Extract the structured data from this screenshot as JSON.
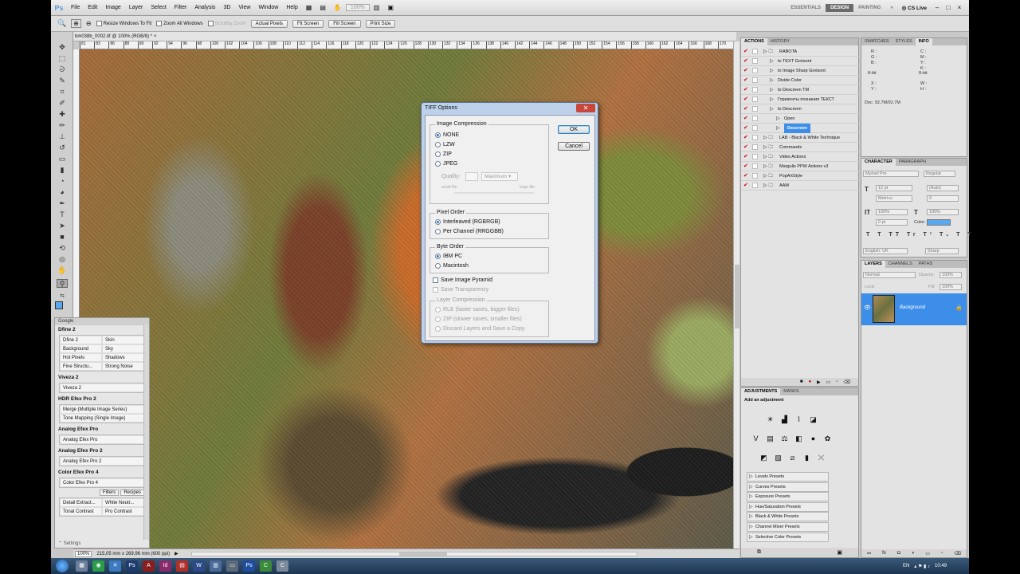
{
  "app": {
    "menu": [
      "File",
      "Edit",
      "Image",
      "Layer",
      "Select",
      "Filter",
      "Analysis",
      "3D",
      "View",
      "Window",
      "Help"
    ],
    "zoom_select": "100%",
    "workspaces": [
      "ESSENTIALS",
      "DESIGN",
      "PAINTING"
    ],
    "active_workspace": "DESIGN",
    "more": "»",
    "cs_live": "CS Live"
  },
  "options": {
    "resize_windows": "Resize Windows To Fit",
    "zoom_all": "Zoom All Windows",
    "scrubby": "Scrubby Zoom",
    "buttons": [
      "Actual Pixels",
      "Fit Screen",
      "Fill Screen",
      "Print Size"
    ]
  },
  "document": {
    "tab": "bm038b_0002.tif @ 100% (RGB/8) *",
    "ruler_ticks": [
      "81",
      "83",
      "86",
      "88",
      "90",
      "92",
      "94",
      "96",
      "98",
      "100",
      "102",
      "104",
      "106",
      "108",
      "110",
      "112",
      "114",
      "116",
      "118",
      "120",
      "122",
      "124",
      "126",
      "128",
      "130",
      "132",
      "134",
      "136",
      "138",
      "140",
      "142",
      "144",
      "146",
      "148",
      "150",
      "152",
      "154",
      "156",
      "158",
      "160",
      "162",
      "164",
      "166",
      "168",
      "170"
    ],
    "status_zoom": "100%",
    "status_size": "215,05 mm x 269,96 mm (600 ppi)"
  },
  "google_panel": {
    "title": "Google",
    "sections": [
      {
        "name": "Dfine 2",
        "items": [
          "Dfine 2",
          "Skin",
          "Background",
          "Sky",
          "Hot Pixels",
          "Shadows",
          "Fine Structu...",
          "Strong Noise"
        ]
      },
      {
        "name": "Viveza 2",
        "items": [
          "Viveza 2"
        ]
      },
      {
        "name": "HDR Efex Pro 2",
        "items": [
          "Merge (Multiple Image Series)",
          "Tone Mapping (Single Image)"
        ]
      },
      {
        "name": "Analog Efex Pro",
        "items": [
          "Analog Efex Pro"
        ]
      },
      {
        "name": "Analog Efex Pro 2",
        "items": [
          "Analog Efex Pro 2"
        ]
      },
      {
        "name": "Color Efex Pro 4",
        "items": [
          "Color Efex Pro 4"
        ]
      }
    ],
    "tabs": [
      "Filters",
      "Recipes"
    ],
    "bottom_items": [
      "Detail Extract...",
      "White Neutr...",
      "Tonal Contrast",
      "Pro Contrast"
    ],
    "settings": "Settings"
  },
  "dialog": {
    "title": "TIFF Options",
    "ok": "OK",
    "cancel": "Cancel",
    "image_compression": {
      "label": "Image Compression",
      "options": [
        "NONE",
        "LZW",
        "ZIP",
        "JPEG"
      ],
      "selected": "NONE",
      "quality_label": "Quality:",
      "quality_select": "Maximum",
      "small_file": "small file",
      "large_file": "large file"
    },
    "pixel_order": {
      "label": "Pixel Order",
      "options": [
        "Interleaved (RGBRGB)",
        "Per Channel (RRGGBB)"
      ],
      "selected": "Interleaved (RGBRGB)"
    },
    "byte_order": {
      "label": "Byte Order",
      "options": [
        "IBM PC",
        "Macintosh"
      ],
      "selected": "IBM PC"
    },
    "save_pyramid": "Save Image Pyramid",
    "save_transparency": "Save Transparency",
    "layer_compression": {
      "label": "Layer Compression",
      "options": [
        "RLE (faster saves, bigger files)",
        "ZIP (slower saves, smaller files)",
        "Discard Layers and Save a Copy"
      ]
    }
  },
  "actions_panel": {
    "tabs": [
      "ACTIONS",
      "HISTORY"
    ],
    "rows": [
      {
        "label": "RABOTA",
        "indent": 0,
        "hl": false
      },
      {
        "label": "to TEXT Gorisont",
        "indent": 1,
        "hl": false
      },
      {
        "label": "to Image Sharp Gorisont",
        "indent": 1,
        "hl": false
      },
      {
        "label": "Divide Color",
        "indent": 1,
        "hl": false
      },
      {
        "label": "to Descreen TM",
        "indent": 1,
        "hl": false
      },
      {
        "label": "Горизонты познания ТЕКСТ",
        "indent": 1,
        "hl": false
      },
      {
        "label": "to Descreen",
        "indent": 1,
        "hl": false
      },
      {
        "label": "Open",
        "indent": 2,
        "hl": false
      },
      {
        "label": "Descreen",
        "indent": 2,
        "hl": true
      },
      {
        "label": "LAB - Black & White Technique",
        "indent": 0,
        "hl": false
      },
      {
        "label": "Commands",
        "indent": 0,
        "hl": false
      },
      {
        "label": "Video Actions",
        "indent": 0,
        "hl": false
      },
      {
        "label": "Margulis PPW Actions v3",
        "indent": 0,
        "hl": false
      },
      {
        "label": "PopArtStyle",
        "indent": 0,
        "hl": false
      },
      {
        "label": "AAW",
        "indent": 0,
        "hl": false
      }
    ]
  },
  "info_panel": {
    "tabs": [
      "SWATCHES",
      "STYLES",
      "INFO"
    ],
    "rgb_labels": [
      "R :",
      "G :",
      "B :"
    ],
    "cmyk_labels": [
      "C :",
      "M :",
      "Y :",
      "K :"
    ],
    "bit_left": "8-bit",
    "bit_right": "8-bit",
    "xy": [
      "X :",
      "Y :"
    ],
    "wh": [
      "W :",
      "H :"
    ],
    "doc": "Doc: 92,7M/92,7M"
  },
  "character_panel": {
    "tabs": [
      "CHARACTER",
      "PARAGRAPH"
    ],
    "font": "Myriad Pro",
    "style": "Regular",
    "size": "12 pt",
    "leading": "(Auto)",
    "kerning": "Metrics",
    "tracking": "0",
    "vscale": "100%",
    "hscale": "100%",
    "baseline": "0 pt",
    "color_label": "Color:",
    "language": "English: UK",
    "aa": "Sharp"
  },
  "layers_panel": {
    "tabs": [
      "LAYERS",
      "CHANNELS",
      "PATHS"
    ],
    "blend": "Normal",
    "opacity_label": "Opacity:",
    "opacity": "100%",
    "lock_label": "Lock:",
    "fill_label": "Fill:",
    "fill": "100%",
    "layer_name": "Background"
  },
  "adjustments_panel": {
    "tabs": [
      "ADJUSTMENTS",
      "MASKS"
    ],
    "heading": "Add an adjustment",
    "presets": [
      "Levels Presets",
      "Curves Presets",
      "Exposure Presets",
      "Hue/Saturation Presets",
      "Black & White Presets",
      "Channel Mixer Presets",
      "Selective Color Presets"
    ]
  },
  "taskbar": {
    "lang": "EN",
    "time": "10:49"
  },
  "colors": {
    "highlight": "#3d8ee8",
    "dialog_frame": "#bdd1ea"
  }
}
